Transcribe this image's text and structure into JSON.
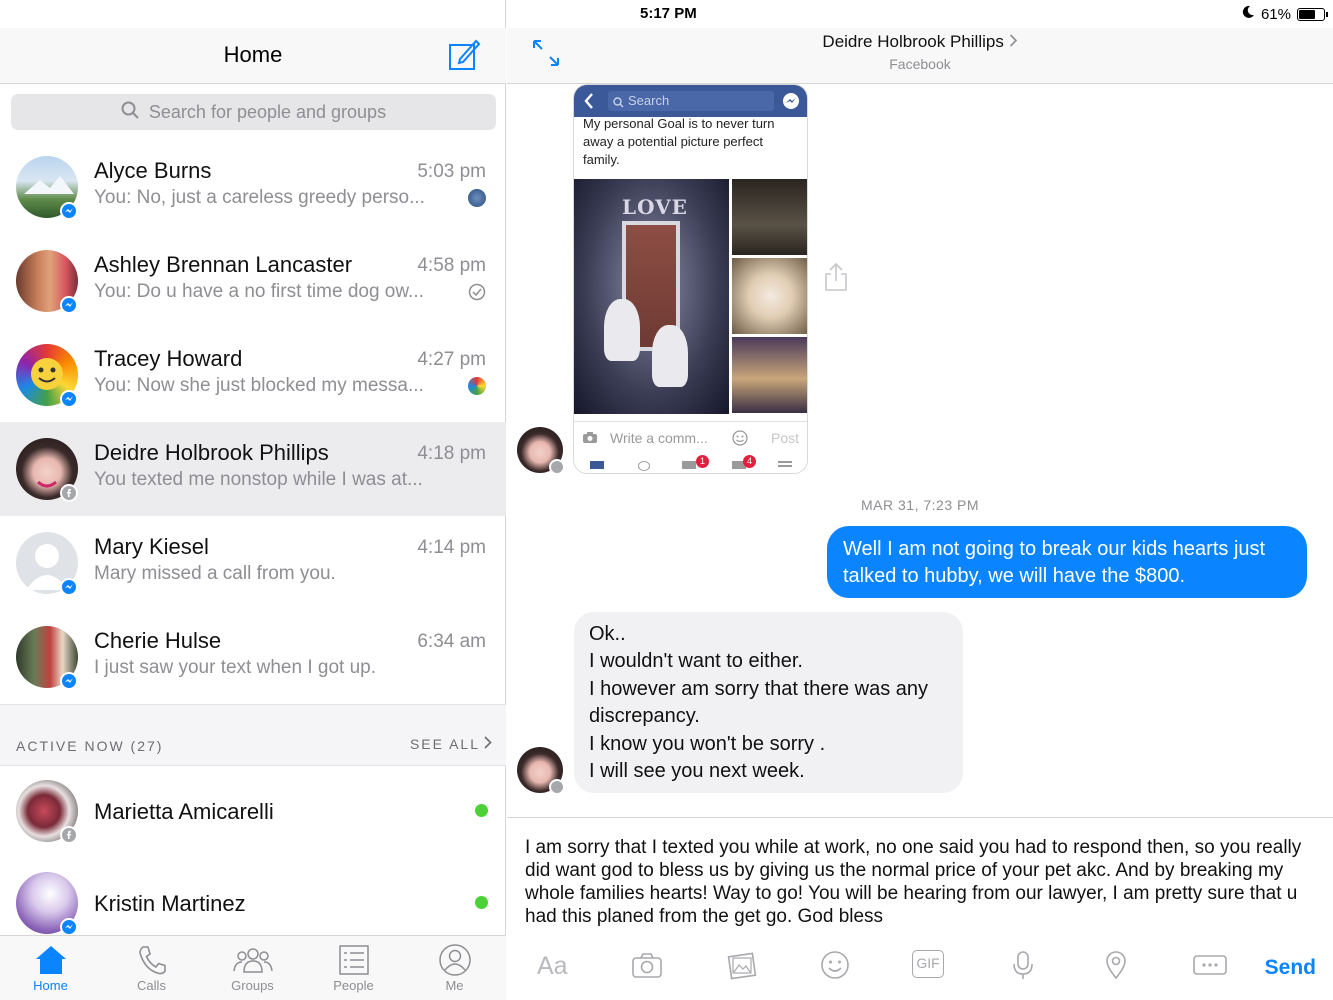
{
  "status_bar": {
    "time": "5:17 PM",
    "battery": "61%"
  },
  "left_header": {
    "title": "Home"
  },
  "search": {
    "placeholder": "Search for people and groups"
  },
  "conversations": [
    {
      "name": "Alyce Burns",
      "time": "5:03 pm",
      "preview": "You: No, just a careless greedy perso..."
    },
    {
      "name": "Ashley Brennan Lancaster",
      "time": "4:58 pm",
      "preview": "You: Do u have a no first time dog ow..."
    },
    {
      "name": "Tracey Howard",
      "time": "4:27 pm",
      "preview": "You: Now she just blocked my messa..."
    },
    {
      "name": "Deidre Holbrook Phillips",
      "time": "4:18 pm",
      "preview": "You texted me nonstop while I was at..."
    },
    {
      "name": "Mary Kiesel",
      "time": "4:14 pm",
      "preview": "Mary missed a call from you."
    },
    {
      "name": "Cherie Hulse",
      "time": "6:34 am",
      "preview": "I just saw your text when I got up."
    }
  ],
  "active_now": {
    "label": "ACTIVE NOW (27)",
    "see_all": "SEE ALL"
  },
  "active_people": [
    {
      "name": "Marietta Amicarelli"
    },
    {
      "name": "Kristin Martinez"
    }
  ],
  "tabs": [
    {
      "label": "Home",
      "icon": "home-icon"
    },
    {
      "label": "Calls",
      "icon": "phone-icon"
    },
    {
      "label": "Groups",
      "icon": "groups-icon"
    },
    {
      "label": "People",
      "icon": "people-list-icon"
    },
    {
      "label": "Me",
      "icon": "profile-icon"
    }
  ],
  "chat": {
    "title": "Deidre Holbrook Phillips",
    "subtitle": "Facebook",
    "shared_screenshot": {
      "search": "Search",
      "caption": "My personal Goal is to never turn away a potential picture perfect family.",
      "comment_placeholder": "Write a comm...",
      "post": "Post",
      "love_text": "LOVE",
      "badge_1": "1",
      "badge_2": "4"
    },
    "date_separator": "MAR 31, 7:23 PM",
    "outgoing_message": "Well I am not going to break our kids hearts just talked to hubby, we will have the $800.",
    "incoming_lines": [
      "Ok..",
      "I wouldn't want to either.",
      "I however am sorry that there was any discrepancy.",
      "I know you won't be sorry .",
      "I will see you next week."
    ]
  },
  "composer": {
    "draft": "I am sorry that I texted you while at work, no one said you had to respond then, so you really did want god to bless us by giving us the normal price of your pet akc. And by breaking my whole families hearts! Way to go! You will be hearing from our lawyer, I am pretty sure that u had this planed from the get go. God bless",
    "aa_label": "Aa",
    "gif_label": "GIF",
    "send_label": "Send"
  },
  "colors": {
    "accent": "#0a84ff",
    "online": "#4cd137",
    "bubble_in": "#f1f1f3"
  }
}
